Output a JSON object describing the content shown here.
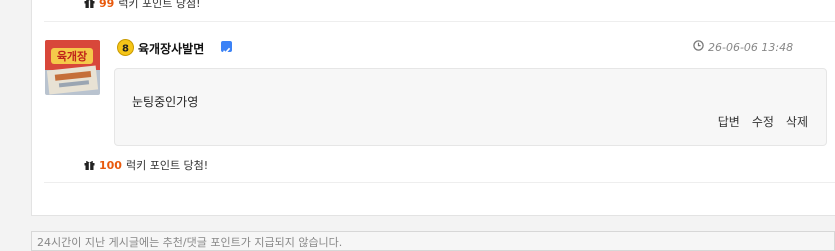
{
  "prev_reward": {
    "points": "99",
    "suffix": " 럭키 포인트 당첨!"
  },
  "comment": {
    "level": "8",
    "nickname": "육개장사발면",
    "timestamp": "26-06-06 13:48",
    "body": "눈팅중인가영",
    "actions": {
      "reply": "답변",
      "edit": "수정",
      "delete": "삭제"
    },
    "reward": {
      "points": "100",
      "suffix": " 럭키 포인트 당첨!"
    },
    "avatar_text": "육개장"
  },
  "notice": "24시간이 지난 게시글에는 추천/댓글 포인트가 지급되지 않습니다.",
  "colors": {
    "points": "#e8590c",
    "verified": "#3b82f6",
    "level_badge": "#f5c518"
  }
}
